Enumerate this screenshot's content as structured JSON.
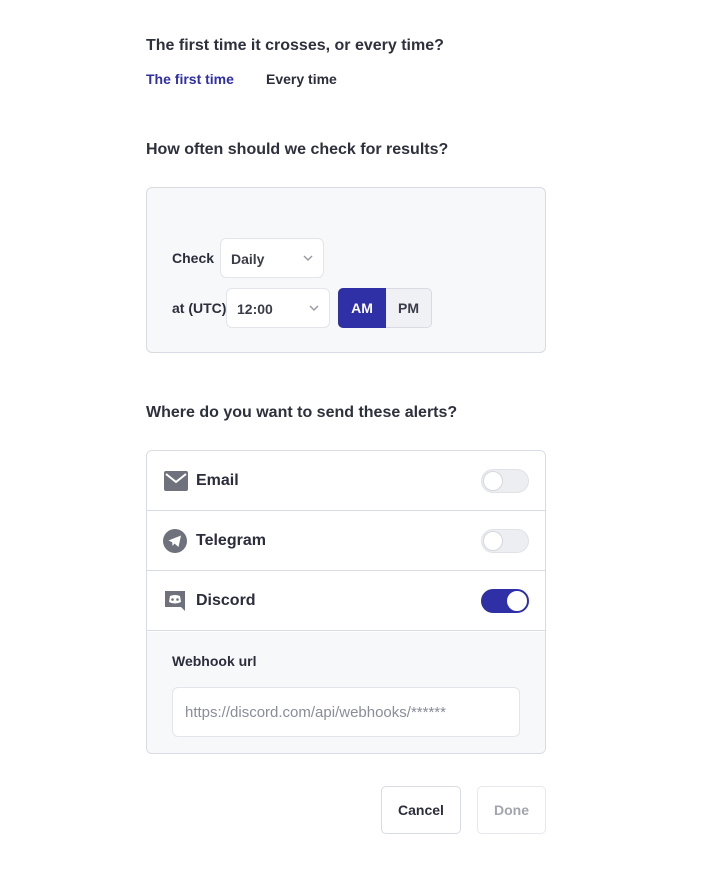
{
  "crossing": {
    "question": "The first time it crosses, or every time?",
    "options": [
      {
        "label": "The first time",
        "selected": true
      },
      {
        "label": "Every time",
        "selected": false
      }
    ]
  },
  "schedule": {
    "question": "How often should we check for results?",
    "check_label": "Check",
    "check_value": "Daily",
    "time_label": "at (UTC)",
    "time_value": "12:00",
    "am_label": "AM",
    "pm_label": "PM",
    "period_selected": "AM"
  },
  "alerts": {
    "question": "Where do you want to send these alerts?",
    "channels": [
      {
        "name": "Email",
        "icon": "envelope-icon",
        "enabled": false
      },
      {
        "name": "Telegram",
        "icon": "telegram-icon",
        "enabled": false
      },
      {
        "name": "Discord",
        "icon": "discord-icon",
        "enabled": true
      }
    ],
    "webhook": {
      "label": "Webhook url",
      "placeholder": "https://discord.com/api/webhooks/******",
      "value": ""
    }
  },
  "actions": {
    "cancel_label": "Cancel",
    "done_label": "Done"
  },
  "colors": {
    "accent": "#2f2fa6",
    "text": "#2b2d3a",
    "panel_bg": "#f7f8fa",
    "border": "#d9dbe3"
  }
}
